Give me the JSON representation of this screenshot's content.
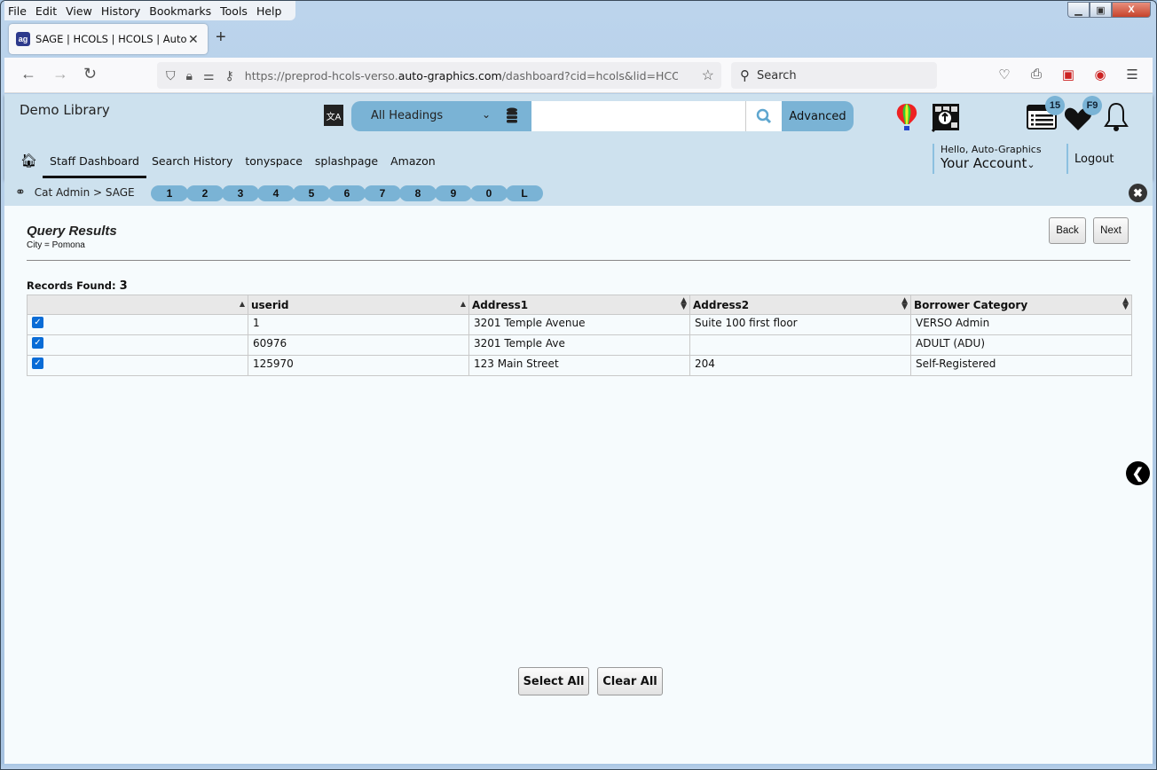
{
  "browser": {
    "menu": [
      "File",
      "Edit",
      "View",
      "History",
      "Bookmarks",
      "Tools",
      "Help"
    ],
    "tab_title": "SAGE | HCOLS | HCOLS | Auto-Graphics",
    "url_prefix": "https://preprod-hcols-verso.",
    "url_domain": "auto-graphics.com",
    "url_suffix": "/dashboard?cid=hcols&lid=HCOLS",
    "search_placeholder": "Search",
    "window_controls": {
      "minimize": "—",
      "maximize": "□",
      "close": "X"
    }
  },
  "header": {
    "library_name": "Demo Library",
    "search_scope": "All Headings",
    "search_value": "",
    "advanced_label": "Advanced",
    "list_badge": "15",
    "favorites_badge": "F9",
    "hello": "Hello, Auto-Graphics",
    "account_label": "Your Account",
    "logout_label": "Logout"
  },
  "nav": {
    "items": [
      "Staff Dashboard",
      "Search History",
      "tonyspace",
      "splashpage",
      "Amazon"
    ],
    "active": "Staff Dashboard"
  },
  "breadcrumb": {
    "text": "Cat Admin > SAGE",
    "quick_keys": [
      "1",
      "2",
      "3",
      "4",
      "5",
      "6",
      "7",
      "8",
      "9",
      "0",
      "L"
    ]
  },
  "query": {
    "title": "Query Results",
    "subtitle": "City = Pomona",
    "back_label": "Back",
    "next_label": "Next",
    "records_label": "Records Found:",
    "records_count": "3"
  },
  "table": {
    "columns": [
      "",
      "userid",
      "Address1",
      "Address2",
      "Borrower Category"
    ],
    "rows": [
      {
        "checked": true,
        "userid": "1",
        "address1": "3201 Temple Avenue",
        "address2": "Suite 100 first floor",
        "category": "VERSO Admin"
      },
      {
        "checked": true,
        "userid": "60976",
        "address1": "3201 Temple Ave",
        "address2": "",
        "category": "ADULT (ADU)"
      },
      {
        "checked": true,
        "userid": "125970",
        "address1": "123 Main Street",
        "address2": "204",
        "category": "Self-Registered"
      }
    ]
  },
  "actions": {
    "select_all": "Select All",
    "clear_all": "Clear All"
  }
}
